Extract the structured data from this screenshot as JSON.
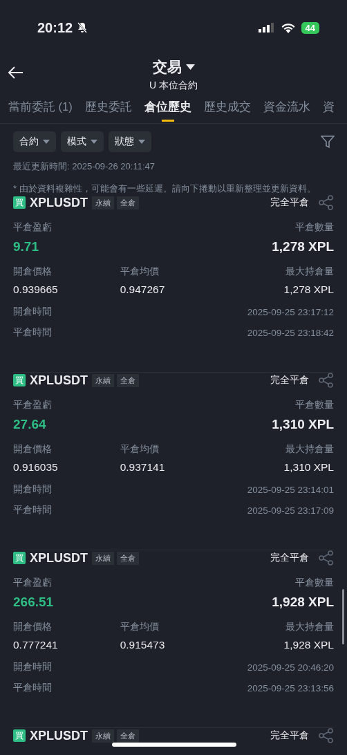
{
  "status_bar": {
    "time": "20:12",
    "battery": "44"
  },
  "header": {
    "title": "交易",
    "subtitle": "U 本位合約"
  },
  "tabs": [
    {
      "label": "當前委託 (1)",
      "selected": false
    },
    {
      "label": "歷史委託",
      "selected": false
    },
    {
      "label": "倉位歷史",
      "selected": true
    },
    {
      "label": "歷史成交",
      "selected": false
    },
    {
      "label": "資金流水",
      "selected": false
    },
    {
      "label": "資",
      "selected": false
    }
  ],
  "filters": [
    "合約",
    "模式",
    "狀態"
  ],
  "last_updated": "最近更新時間: 2025-09-26 20:11:47",
  "notice": "* 由於資料複雜性，可能會有一些延遲。請向下捲動以重新整理並更新資料。",
  "positions": [
    {
      "side": "買",
      "symbol": "XPLUSDT",
      "tags": [
        "永續",
        "全倉"
      ],
      "status": "完全平倉",
      "pnl_label": "平倉盈虧",
      "pnl": "9.71",
      "qty_label": "平倉數量",
      "qty": "1,278 XPL",
      "open_price_label": "開倉價格",
      "open_price": "0.939665",
      "close_price_label": "平倉均價",
      "close_price": "0.947267",
      "max_label": "最大持倉量",
      "max": "1,278 XPL",
      "open_time_label": "開倉時間",
      "open_time": "2025-09-25 23:17:12",
      "close_time_label": "平倉時間",
      "close_time": "2025-09-25 23:18:42"
    },
    {
      "side": "買",
      "symbol": "XPLUSDT",
      "tags": [
        "永續",
        "全倉"
      ],
      "status": "完全平倉",
      "pnl_label": "平倉盈虧",
      "pnl": "27.64",
      "qty_label": "平倉數量",
      "qty": "1,310 XPL",
      "open_price_label": "開倉價格",
      "open_price": "0.916035",
      "close_price_label": "平倉均價",
      "close_price": "0.937141",
      "max_label": "最大持倉量",
      "max": "1,310 XPL",
      "open_time_label": "開倉時間",
      "open_time": "2025-09-25 23:14:01",
      "close_time_label": "平倉時間",
      "close_time": "2025-09-25 23:17:09"
    },
    {
      "side": "買",
      "symbol": "XPLUSDT",
      "tags": [
        "永續",
        "全倉"
      ],
      "status": "完全平倉",
      "pnl_label": "平倉盈虧",
      "pnl": "266.51",
      "qty_label": "平倉數量",
      "qty": "1,928 XPL",
      "open_price_label": "開倉價格",
      "open_price": "0.777241",
      "close_price_label": "平倉均價",
      "close_price": "0.915473",
      "max_label": "最大持倉量",
      "max": "1,928 XPL",
      "open_time_label": "開倉時間",
      "open_time": "2025-09-25 20:46:20",
      "close_time_label": "平倉時間",
      "close_time": "2025-09-25 23:13:56"
    },
    {
      "side": "買",
      "symbol": "XPLUSDT",
      "tags": [
        "永續",
        "全倉"
      ],
      "status": "完全平倉"
    }
  ]
}
